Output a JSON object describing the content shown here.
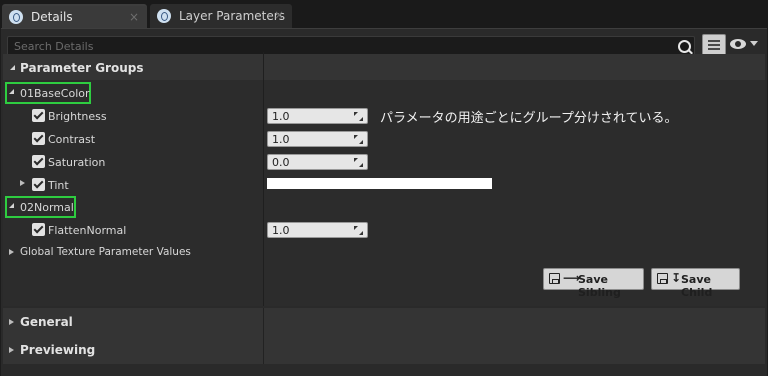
{
  "tabs": [
    {
      "label": "Details",
      "close": "×"
    },
    {
      "label": "Layer Parameters",
      "close": "×"
    }
  ],
  "search": {
    "placeholder": "Search Details"
  },
  "categories": {
    "parameter_groups": "Parameter Groups",
    "general": "General",
    "previewing": "Previewing"
  },
  "groups": [
    {
      "name": "01BaseColor",
      "params": [
        {
          "label": "Brightness",
          "checked": true,
          "value": "1.0"
        },
        {
          "label": "Contrast",
          "checked": true,
          "value": "1.0"
        },
        {
          "label": "Saturation",
          "checked": true,
          "value": "0.0"
        },
        {
          "label": "Tint",
          "checked": true,
          "value": "",
          "color": "#ffffff"
        }
      ]
    },
    {
      "name": "02Normal",
      "params": [
        {
          "label": "FlattenNormal",
          "checked": true,
          "value": "1.0"
        }
      ]
    }
  ],
  "global_texture": "Global Texture Parameter Values",
  "note": "パラメータの用途ごとにグループ分けされている。",
  "buttons": {
    "save_sibling": "Save Sibling",
    "save_sibling_glyph": "⟶",
    "save_child": "Save Child",
    "save_child_glyph": "↧"
  },
  "colors": {
    "highlight": "#2ecc40",
    "panel": "#2a2a2a"
  }
}
